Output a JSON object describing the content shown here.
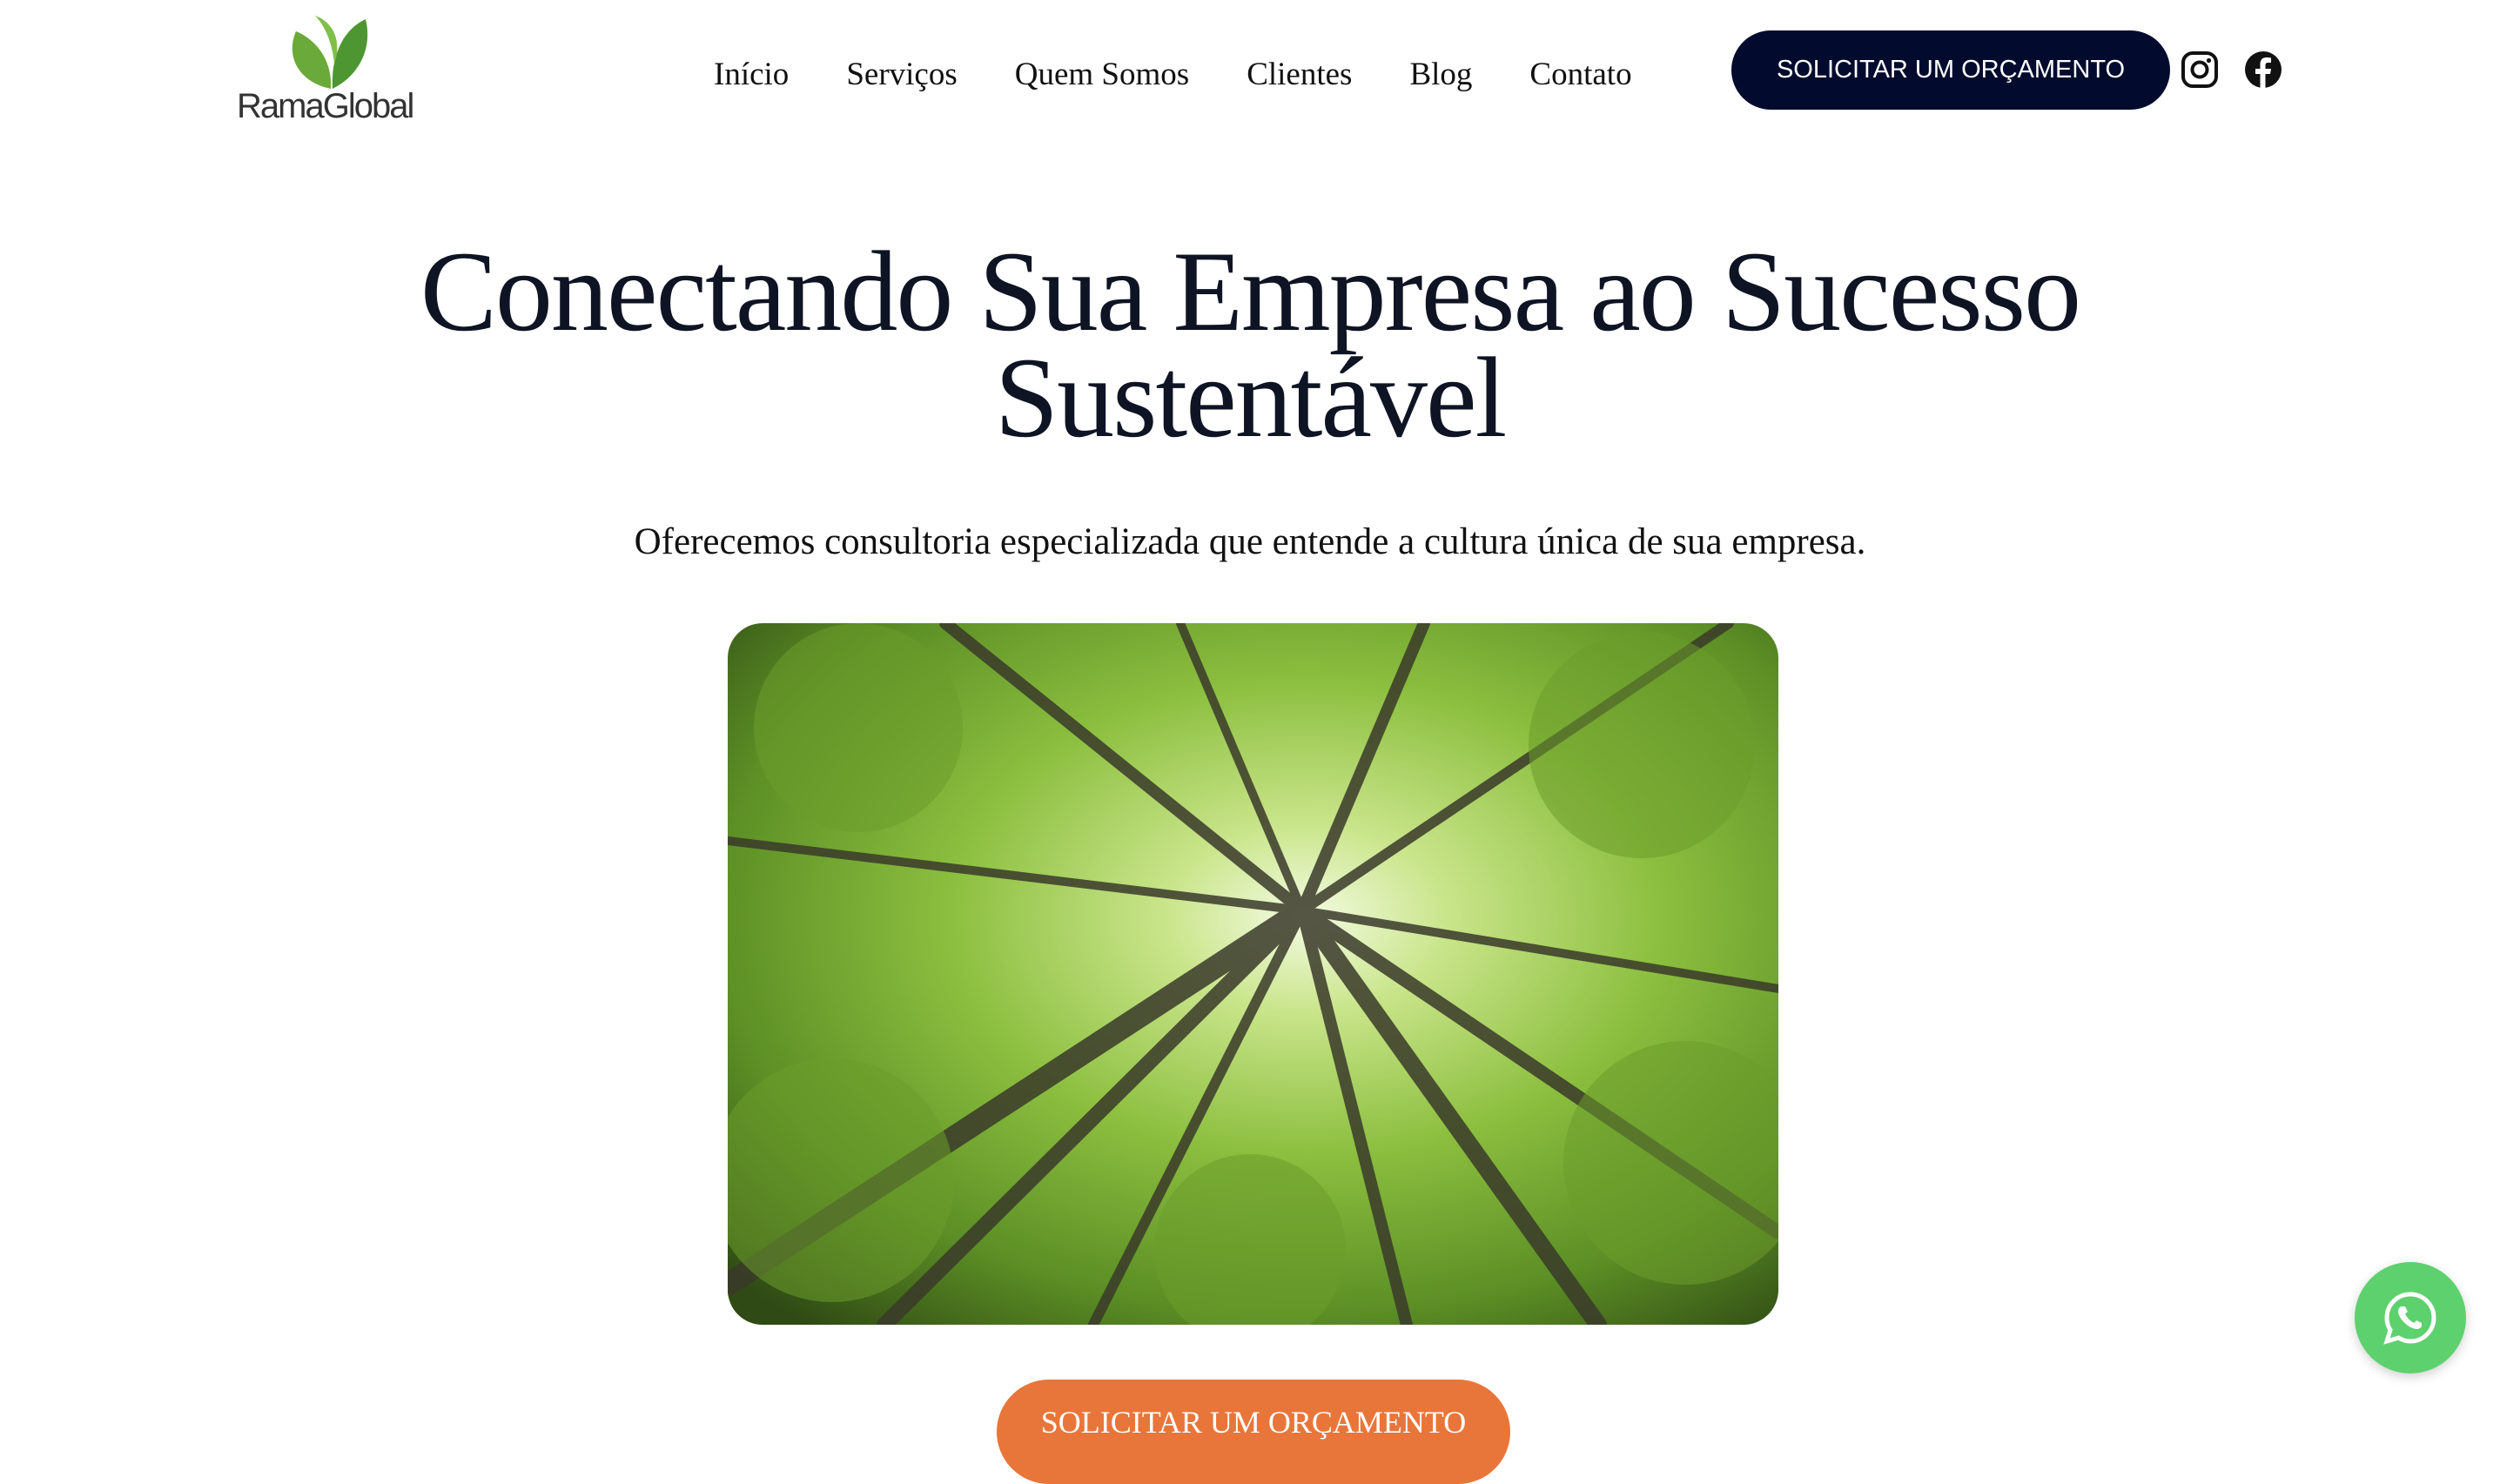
{
  "brand": {
    "name_part1": "Rama",
    "name_part2": "Global",
    "leaf_color": "#5a9e37"
  },
  "nav": {
    "items": [
      {
        "label": "Início"
      },
      {
        "label": "Serviços"
      },
      {
        "label": "Quem Somos"
      },
      {
        "label": "Clientes"
      },
      {
        "label": "Blog"
      },
      {
        "label": "Contato"
      }
    ],
    "cta_label": "SOLICITAR UM ORÇAMENTO",
    "social": [
      "instagram-icon",
      "facebook-icon"
    ]
  },
  "hero": {
    "title_line1": "Conectando Sua Empresa ao Sucesso",
    "title_line2": "Sustentável",
    "subtitle": "Oferecemos consultoria especializada que entende a cultura única de sua empresa.",
    "image_subject": "forest canopy viewed from below",
    "cta_label": "SOLICITAR UM ORÇAMENTO"
  },
  "colors": {
    "primary_dark": "#020b2e",
    "cta_orange": "#e8763a",
    "whatsapp_green": "#5dd16e"
  },
  "floating": {
    "icon": "whatsapp-icon"
  }
}
